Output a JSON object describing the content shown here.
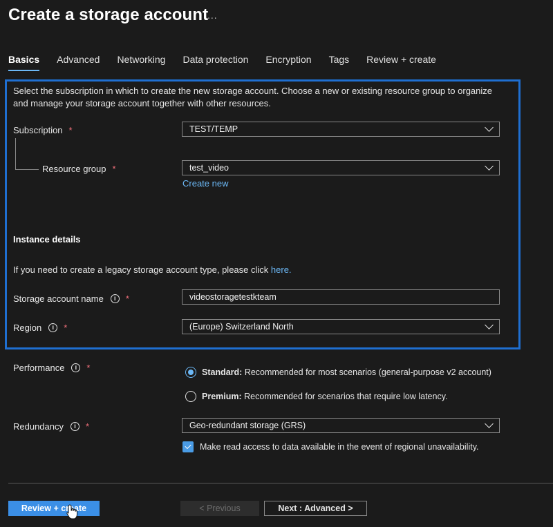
{
  "page": {
    "title": "Create a storage account",
    "more_icon": "ellipsis-icon",
    "more_text": "..."
  },
  "tabs": [
    {
      "label": "Basics",
      "active": true
    },
    {
      "label": "Advanced"
    },
    {
      "label": "Networking"
    },
    {
      "label": "Data protection"
    },
    {
      "label": "Encryption"
    },
    {
      "label": "Tags"
    },
    {
      "label": "Review + create"
    }
  ],
  "project": {
    "description": "Select the subscription in which to create the new storage account. Choose a new or existing resource group to organize and manage your storage account together with other resources.",
    "subscription": {
      "label": "Subscription",
      "required": "*",
      "value": "TEST/TEMP"
    },
    "resource_group": {
      "label": "Resource group",
      "required": "*",
      "value": "test_video",
      "create_new": "Create new"
    }
  },
  "instance": {
    "heading": "Instance details",
    "legacy_text": "If you need to create a legacy storage account type, please click",
    "legacy_link": "here.",
    "name": {
      "label": "Storage account name",
      "required": "*",
      "value": "videostoragetestkteam"
    },
    "region": {
      "label": "Region",
      "required": "*",
      "value": "(Europe) Switzerland North"
    }
  },
  "performance": {
    "label": "Performance",
    "required": "*",
    "options": [
      {
        "title": "Standard:",
        "desc": "Recommended for most scenarios (general-purpose v2 account)",
        "selected": true
      },
      {
        "title": "Premium:",
        "desc": "Recommended for scenarios that require low latency.",
        "selected": false
      }
    ]
  },
  "redundancy": {
    "label": "Redundancy",
    "required": "*",
    "value": "Geo-redundant storage (GRS)",
    "read_access": {
      "label": "Make read access to data available in the event of regional unavailability.",
      "checked": true
    }
  },
  "footer": {
    "review_create": "Review + create",
    "previous": "< Previous",
    "next": "Next : Advanced >"
  },
  "colors": {
    "background": "#1b1b1b",
    "accent": "#6cb8f6",
    "highlight_border": "#1f6fd1",
    "primary_button": "#3b8fe6",
    "required": "#f1707b"
  },
  "info_icon": "i"
}
